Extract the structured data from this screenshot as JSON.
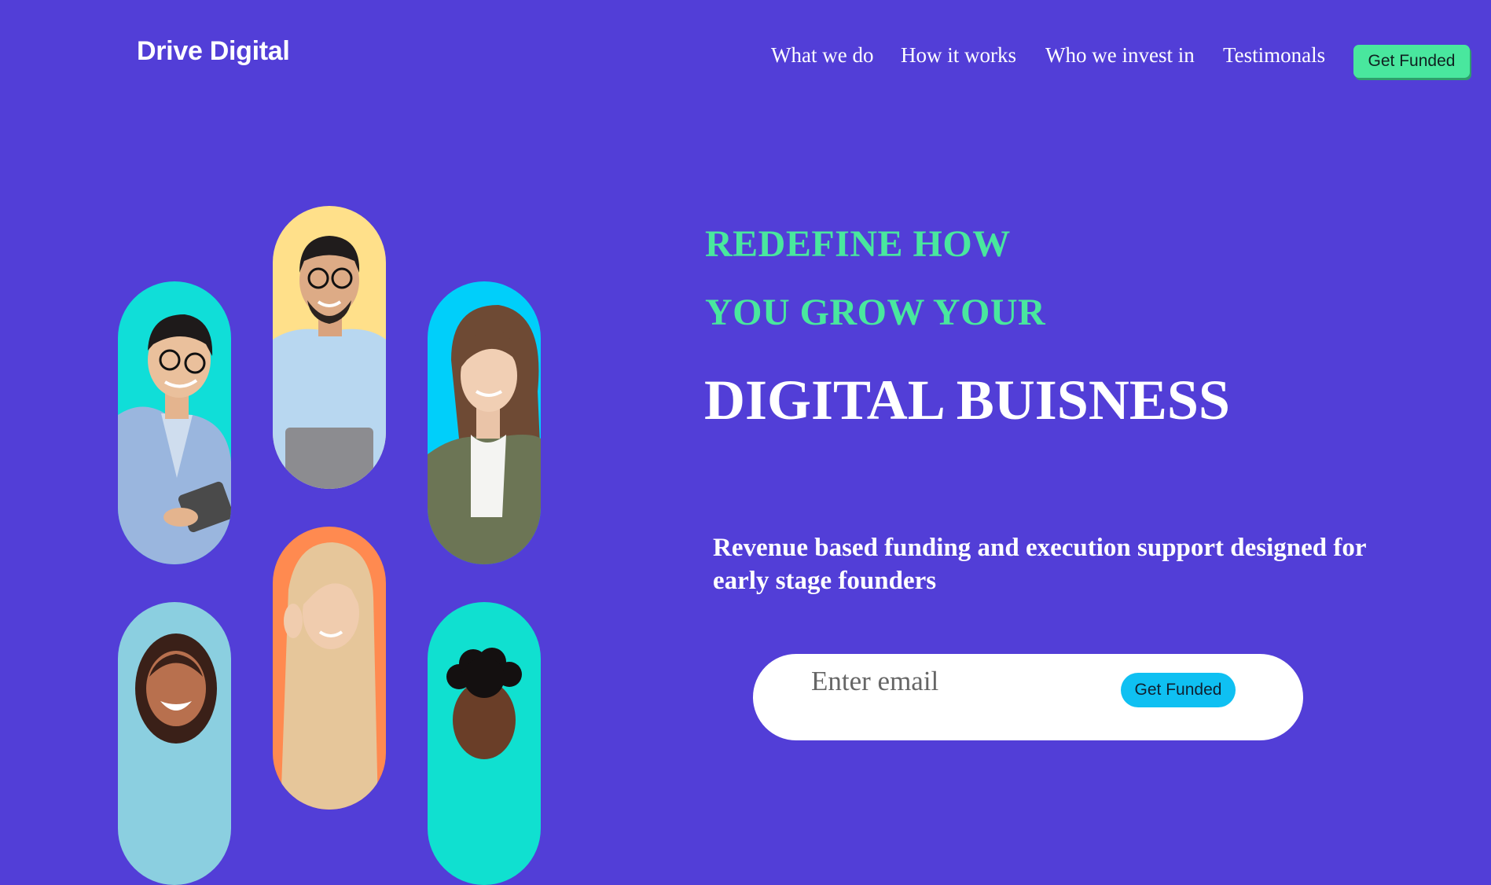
{
  "brand": {
    "name": "Drive Digital"
  },
  "nav": {
    "links": [
      "What we do",
      "How it works",
      "Who we invest in",
      "Testimonals"
    ],
    "cta_label": "Get Funded"
  },
  "hero": {
    "headline_line1": "REDEFINE HOW",
    "headline_line2": "YOU GROW YOUR",
    "headline_line3": "DIGITAL BUISNESS",
    "subtitle": "Revenue based funding and execution support designed for early stage founders"
  },
  "signup": {
    "email_placeholder": "Enter email",
    "button_label": "Get Funded"
  },
  "colors": {
    "background": "#523ED7",
    "accent_green": "#49E79E",
    "accent_cyan": "#0FC0F2",
    "pill_colors": [
      "#10DED8",
      "#FFE08A",
      "#00CFFA",
      "#8BCFE0",
      "#FF8A50",
      "#10E0D0"
    ]
  },
  "images": [
    "man-with-glasses-tablet-photo",
    "man-with-glasses-laptop-photo",
    "smiling-woman-brown-hair-photo",
    "smiling-woman-curly-hair-photo",
    "blonde-woman-phone-photo",
    "man-curly-hair-photo"
  ]
}
